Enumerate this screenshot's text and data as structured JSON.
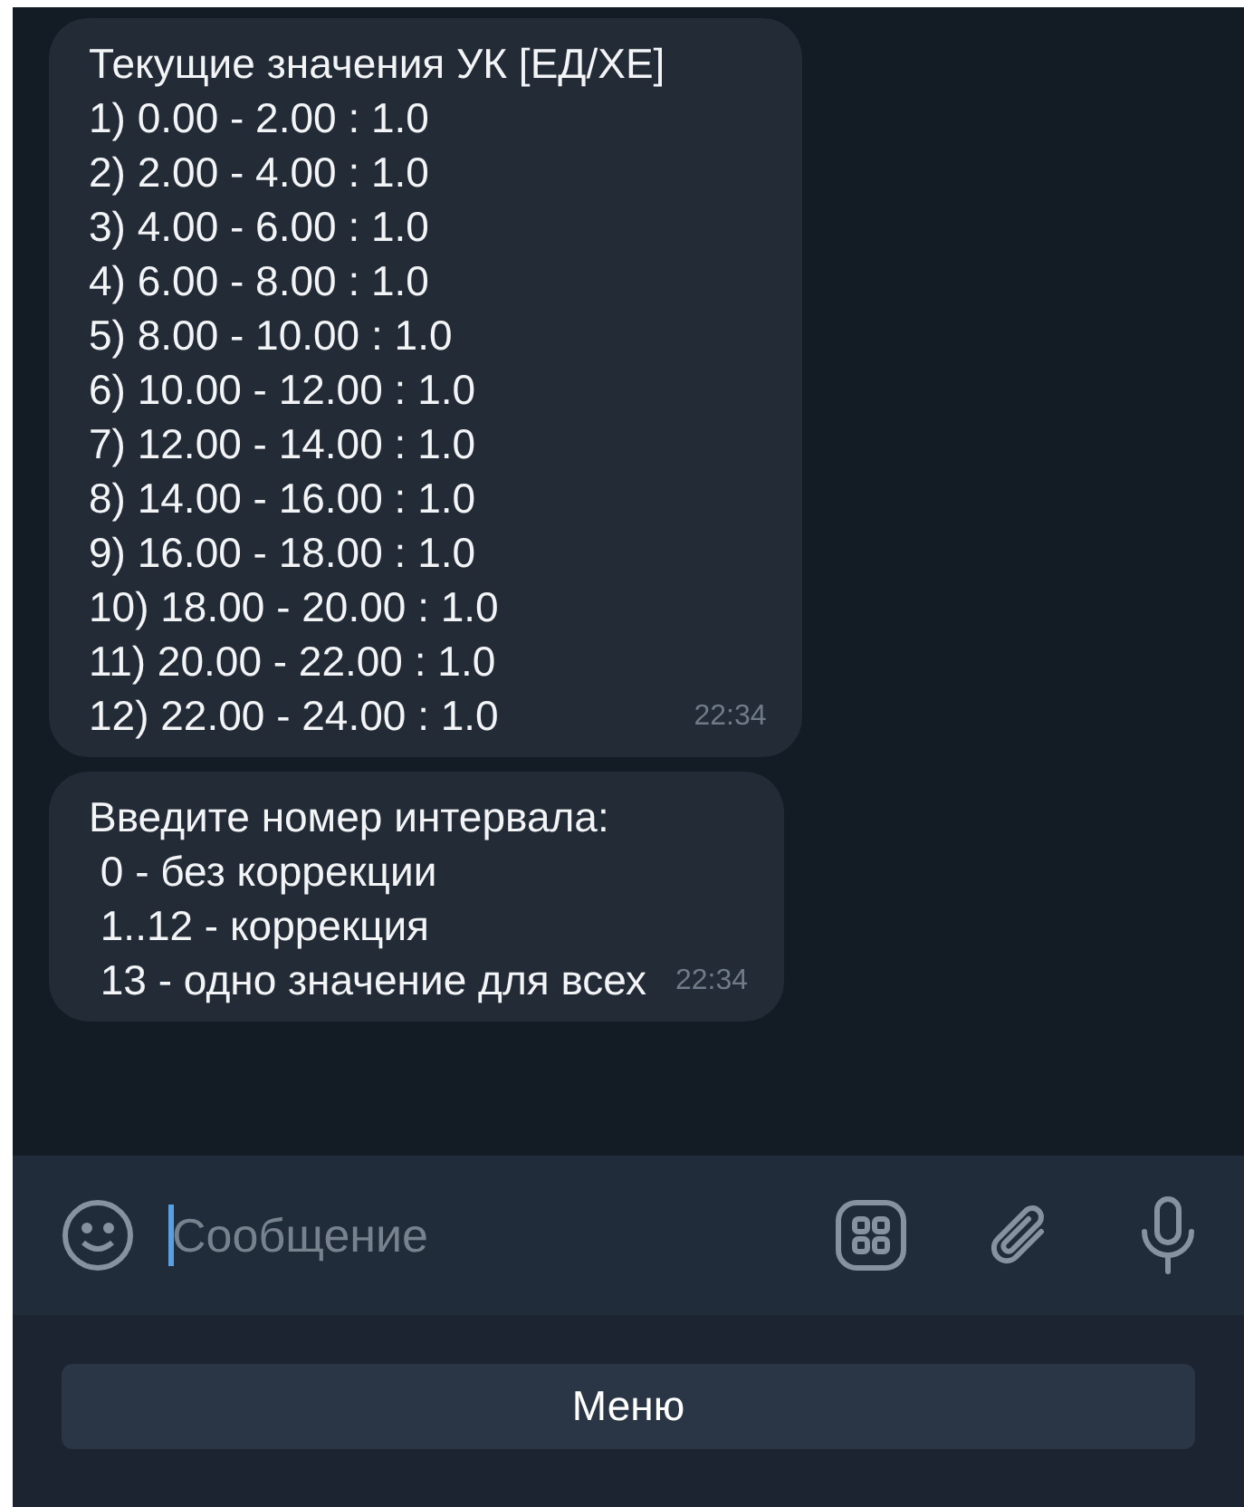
{
  "messages": [
    {
      "lines": [
        "Текущие значения УК [ЕД/ХЕ]",
        "1) 0.00 - 2.00 : 1.0",
        "2) 2.00 - 4.00 : 1.0",
        "3) 4.00 - 6.00 : 1.0",
        "4) 6.00 - 8.00 : 1.0",
        "5) 8.00 - 10.00 : 1.0",
        "6) 10.00 - 12.00 : 1.0",
        "7) 12.00 - 14.00 : 1.0",
        "8) 14.00 - 16.00 : 1.0",
        "9) 16.00 - 18.00 : 1.0",
        "10) 18.00 - 20.00 : 1.0",
        "11) 20.00 - 22.00 : 1.0",
        "12) 22.00 - 24.00 : 1.0"
      ],
      "time": "22:34"
    },
    {
      "lines": [
        "Введите номер интервала:",
        " 0 - без коррекции",
        " 1..12 - коррекция",
        " 13 - одно значение для всех"
      ],
      "time": "22:34"
    }
  ],
  "composer": {
    "placeholder": "Сообщение"
  },
  "keyboard_button": "Меню"
}
